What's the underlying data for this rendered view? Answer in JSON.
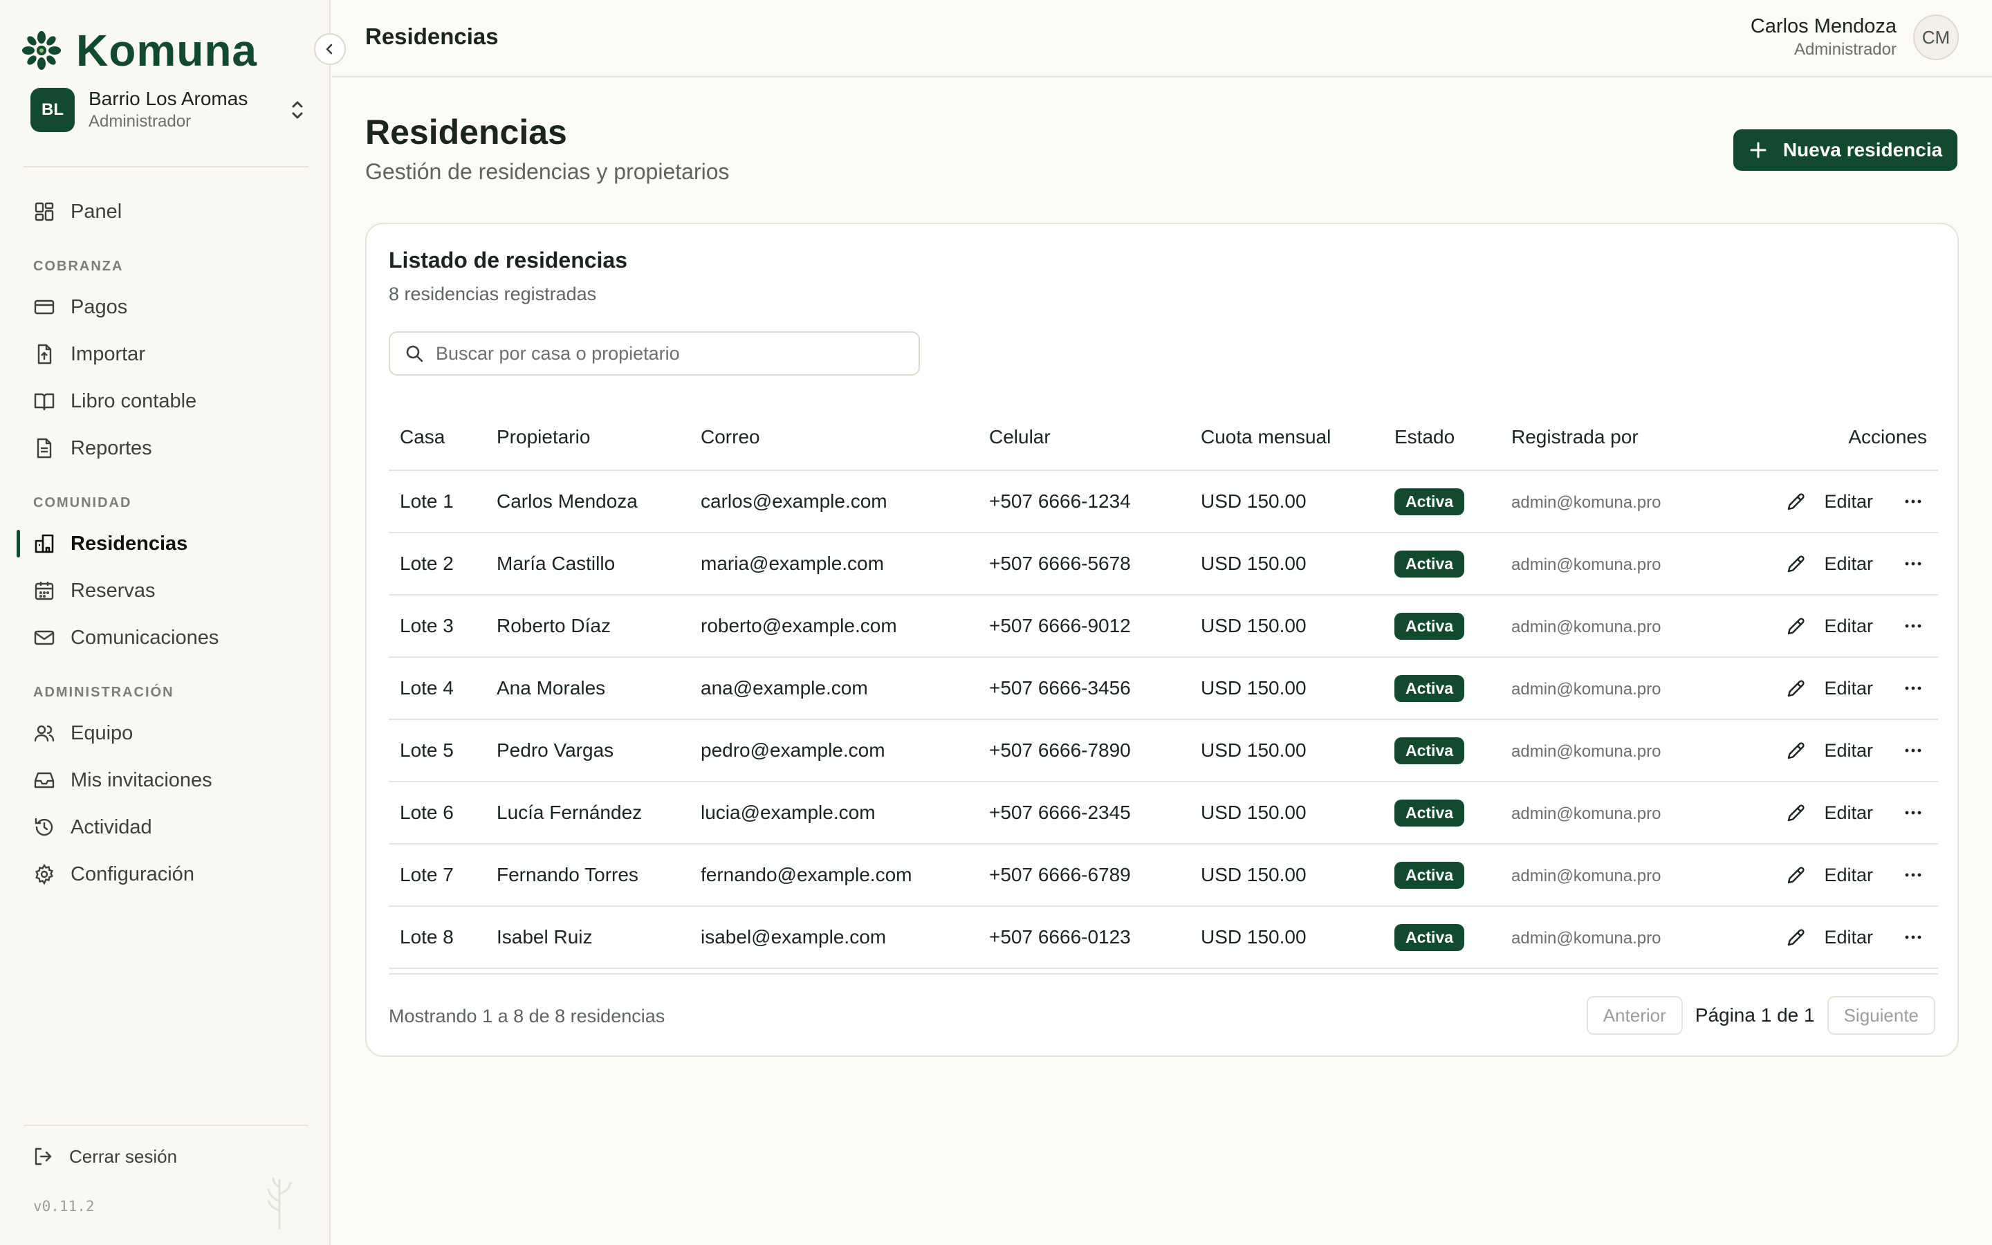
{
  "brand": {
    "name": "Komuna",
    "accent": "#124a2f"
  },
  "org": {
    "initials": "BL",
    "name": "Barrio Los Aromas",
    "role": "Administrador"
  },
  "nav": {
    "panel": "Panel",
    "section_cobranza": "COBRANZA",
    "pagos": "Pagos",
    "importar": "Importar",
    "libro": "Libro contable",
    "reportes": "Reportes",
    "section_comunidad": "COMUNIDAD",
    "residencias": "Residencias",
    "reservas": "Reservas",
    "comunicaciones": "Comunicaciones",
    "section_admin": "ADMINISTRACIÓN",
    "equipo": "Equipo",
    "invitaciones": "Mis invitaciones",
    "actividad": "Actividad",
    "configuracion": "Configuración",
    "active": "residencias"
  },
  "sidebar_footer": {
    "logout": "Cerrar sesión",
    "version": "v0.11.2"
  },
  "topbar": {
    "title": "Residencias",
    "user_name": "Carlos Mendoza",
    "user_role": "Administrador",
    "user_initials": "CM"
  },
  "page": {
    "title": "Residencias",
    "subtitle": "Gestión de residencias y propietarios",
    "new_button": "Nueva residencia"
  },
  "card": {
    "title": "Listado de residencias",
    "subtitle": "8 residencias registradas",
    "search_placeholder": "Buscar por casa o propietario",
    "search_value": ""
  },
  "table": {
    "headers": {
      "casa": "Casa",
      "propietario": "Propietario",
      "correo": "Correo",
      "celular": "Celular",
      "cuota": "Cuota mensual",
      "estado": "Estado",
      "registrada": "Registrada por",
      "acciones": "Acciones"
    },
    "edit_label": "Editar",
    "rows": [
      {
        "casa": "Lote 1",
        "propietario": "Carlos Mendoza",
        "correo": "carlos@example.com",
        "celular": "+507 6666-1234",
        "cuota": "USD 150.00",
        "estado": "Activa",
        "registrada": "admin@komuna.pro"
      },
      {
        "casa": "Lote 2",
        "propietario": "María Castillo",
        "correo": "maria@example.com",
        "celular": "+507 6666-5678",
        "cuota": "USD 150.00",
        "estado": "Activa",
        "registrada": "admin@komuna.pro"
      },
      {
        "casa": "Lote 3",
        "propietario": "Roberto Díaz",
        "correo": "roberto@example.com",
        "celular": "+507 6666-9012",
        "cuota": "USD 150.00",
        "estado": "Activa",
        "registrada": "admin@komuna.pro"
      },
      {
        "casa": "Lote 4",
        "propietario": "Ana Morales",
        "correo": "ana@example.com",
        "celular": "+507 6666-3456",
        "cuota": "USD 150.00",
        "estado": "Activa",
        "registrada": "admin@komuna.pro"
      },
      {
        "casa": "Lote 5",
        "propietario": "Pedro Vargas",
        "correo": "pedro@example.com",
        "celular": "+507 6666-7890",
        "cuota": "USD 150.00",
        "estado": "Activa",
        "registrada": "admin@komuna.pro"
      },
      {
        "casa": "Lote 6",
        "propietario": "Lucía Fernández",
        "correo": "lucia@example.com",
        "celular": "+507 6666-2345",
        "cuota": "USD 150.00",
        "estado": "Activa",
        "registrada": "admin@komuna.pro"
      },
      {
        "casa": "Lote 7",
        "propietario": "Fernando Torres",
        "correo": "fernando@example.com",
        "celular": "+507 6666-6789",
        "cuota": "USD 150.00",
        "estado": "Activa",
        "registrada": "admin@komuna.pro"
      },
      {
        "casa": "Lote 8",
        "propietario": "Isabel Ruiz",
        "correo": "isabel@example.com",
        "celular": "+507 6666-0123",
        "cuota": "USD 150.00",
        "estado": "Activa",
        "registrada": "admin@komuna.pro"
      }
    ]
  },
  "footer": {
    "showing": "Mostrando 1 a 8 de 8 residencias",
    "prev": "Anterior",
    "page_label": "Página 1 de 1",
    "next": "Siguiente"
  },
  "icons": {
    "logo": "leaf-cluster-icon",
    "collapse": "chevron-left-icon",
    "org_switch": "chevrons-up-down-icon",
    "new": "plus-icon",
    "search": "search-icon",
    "edit": "pencil-icon",
    "more": "ellipsis-icon"
  }
}
